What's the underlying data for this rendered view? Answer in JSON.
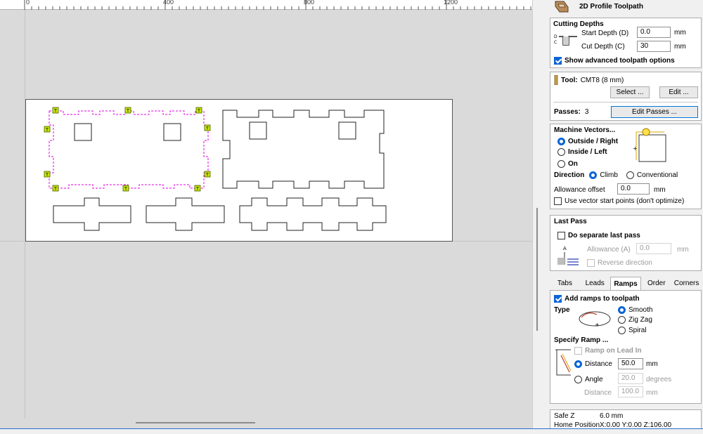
{
  "ruler": {
    "labels": [
      "0",
      "400",
      "800",
      "1200"
    ]
  },
  "header": {
    "title": "2D Profile Toolpath"
  },
  "cutting_depths": {
    "heading": "Cutting Depths",
    "start_label": "Start Depth (D)",
    "start_value": "0.0",
    "cut_label": "Cut Depth (C)",
    "cut_value": "30",
    "unit": "mm",
    "diagram_letters": "D\nC",
    "advanced_label": "Show advanced toolpath options"
  },
  "tool": {
    "label": "Tool:",
    "name": "CMT8 (8 mm)",
    "select_label": "Select ...",
    "edit_label": "Edit ...",
    "passes_label": "Passes:",
    "passes_value": "3",
    "edit_passes_label": "Edit Passes ..."
  },
  "machine_vectors": {
    "heading": "Machine Vectors...",
    "outside": "Outside / Right",
    "inside": "Inside / Left",
    "on": "On",
    "direction_label": "Direction",
    "climb": "Climb",
    "conventional": "Conventional",
    "allowance_label": "Allowance offset",
    "allowance_value": "0.0",
    "unit": "mm",
    "start_points_label": "Use vector start points (don't optimize)"
  },
  "last_pass": {
    "heading": "Last Pass",
    "separate_label": "Do separate last pass",
    "allowance_label": "Allowance (A)",
    "allowance_value": "0.0",
    "unit": "mm",
    "diagram_letter": "A",
    "reverse_label": "Reverse direction"
  },
  "tabs": [
    "Tabs",
    "Leads",
    "Ramps",
    "Order",
    "Corners"
  ],
  "ramps": {
    "add_label": "Add ramps to toolpath",
    "type_label": "Type",
    "smooth": "Smooth",
    "zigzag": "Zig Zag",
    "spiral": "Spiral",
    "specify_label": "Specify Ramp ...",
    "lead_in_label": "Ramp on Lead In",
    "distance_label": "Distance",
    "distance_value": "50.0",
    "distance_unit": "mm",
    "angle_label": "Angle",
    "angle_value": "20.0",
    "angle_unit": "degrees",
    "distance2_label": "Distance",
    "distance2_value": "100.0",
    "distance2_unit": "mm"
  },
  "footer": {
    "safe_z_label": "Safe Z",
    "safe_z_value": "6.0 mm",
    "home_label": "Home Position",
    "home_value": "X:0.00 Y:0.00 Z:106.00"
  },
  "colors": {
    "accent": "#0a64d8",
    "selection": "#e600e6",
    "tab_marker": "#c8e600",
    "canvas": "#dadada"
  }
}
